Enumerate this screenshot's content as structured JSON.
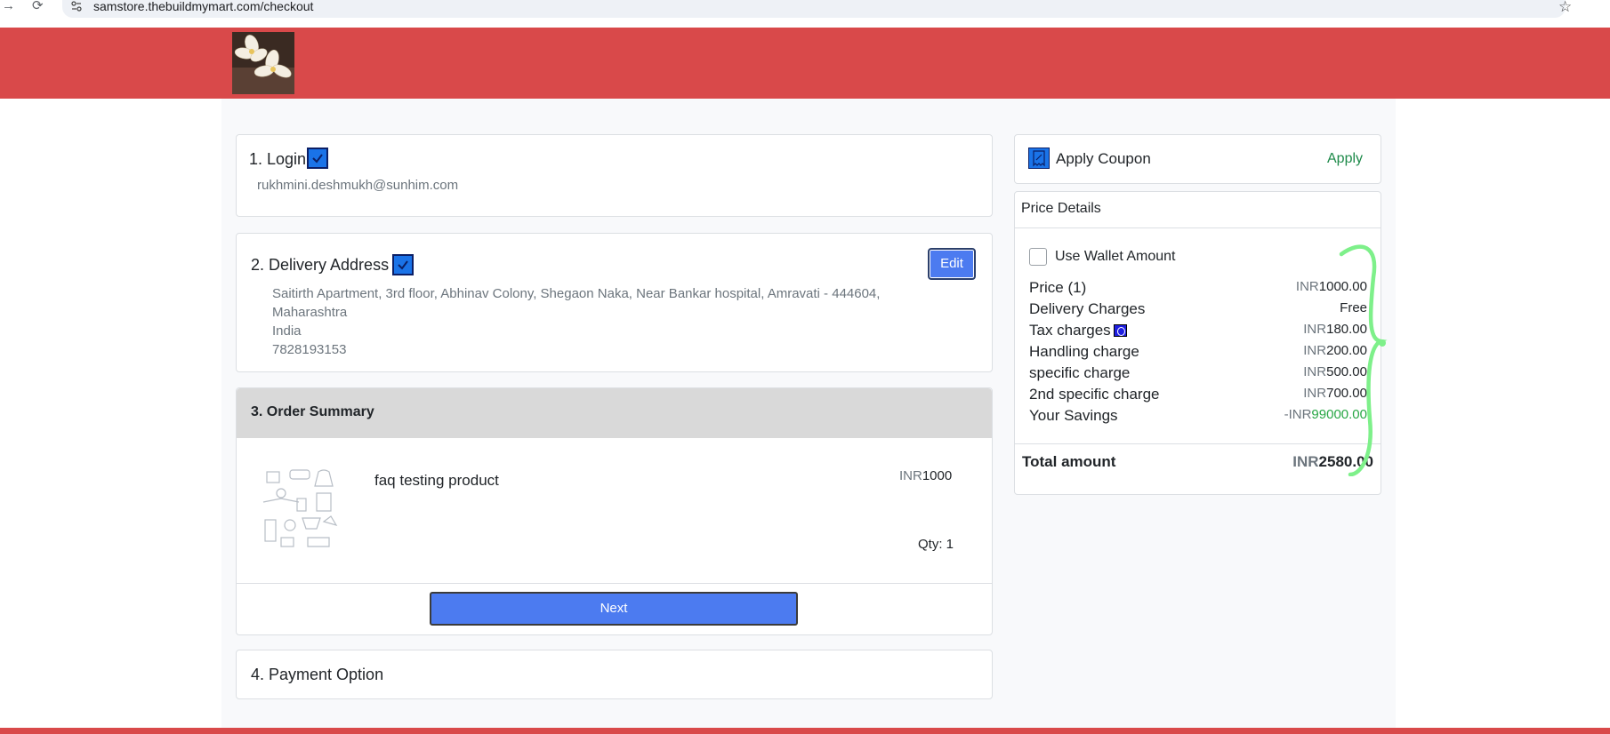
{
  "browser": {
    "url": "samstore.thebuildmymart.com/checkout"
  },
  "colors": {
    "brand": "#d9494a",
    "primary_button": "#4c7bf0",
    "success": "#28a745",
    "check": "#1a73e8"
  },
  "login": {
    "title": "1. Login",
    "email": "rukhmini.deshmukh@sunhim.com"
  },
  "delivery": {
    "title": "2. Delivery Address",
    "edit_label": "Edit",
    "address_line1": "Saitirth Apartment, 3rd floor, Abhinav Colony, Shegaon Naka, Near Bankar hospital, Amravati - 444604,",
    "address_line2": "Maharashtra",
    "country": "India",
    "phone": "7828193153"
  },
  "order": {
    "title": "3. Order Summary",
    "product_name": "faq testing product",
    "currency": "INR",
    "price": "1000",
    "qty_label": "Qty: 1",
    "next_label": "Next"
  },
  "payment": {
    "title": "4. Payment Option"
  },
  "coupon": {
    "title": "Apply Coupon",
    "apply_label": "Apply"
  },
  "price_details": {
    "title": "Price Details",
    "wallet_label": "Use Wallet Amount",
    "rows": [
      {
        "label": "Price (1)",
        "currency": "INR",
        "amount": "1000.00"
      },
      {
        "label": "Delivery Charges",
        "value": "Free"
      },
      {
        "label": "Tax charges",
        "currency": "INR",
        "amount": "180.00"
      },
      {
        "label": "Handling charge",
        "currency": "INR",
        "amount": "200.00"
      },
      {
        "label": "specific charge",
        "currency": "INR",
        "amount": "500.00"
      },
      {
        "label": "2nd specific charge",
        "currency": "INR",
        "amount": "700.00"
      },
      {
        "label": "Your Savings",
        "currency": "-INR",
        "amount": "99000.00"
      }
    ],
    "total_label": "Total amount",
    "total_currency": "INR",
    "total_amount": "2580.00"
  }
}
